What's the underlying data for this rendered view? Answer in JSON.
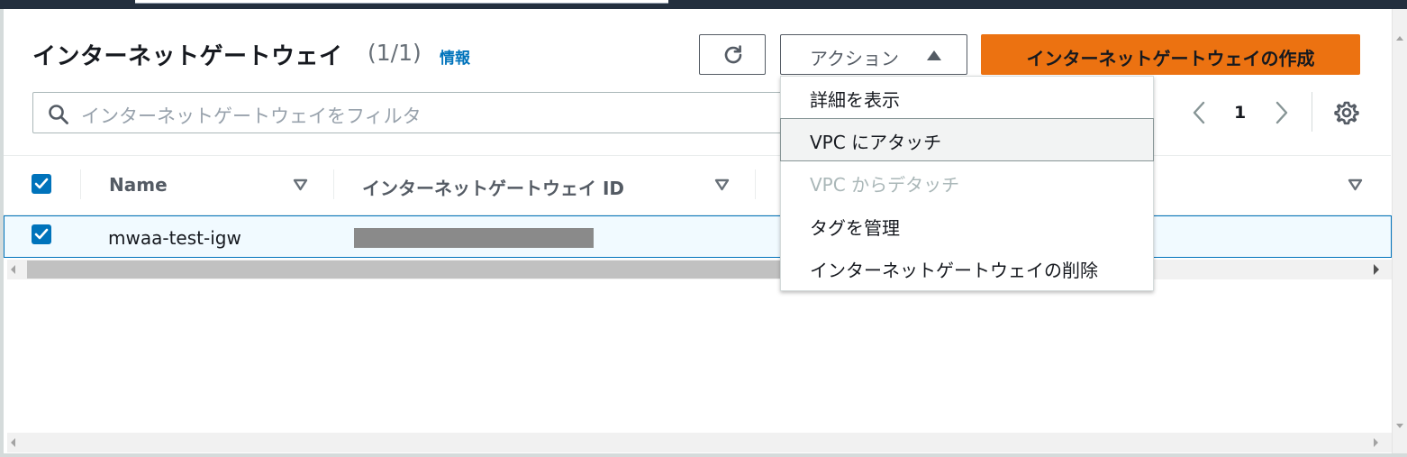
{
  "header": {
    "title": "インターネットゲートウェイ",
    "count": "(1/1)",
    "info_link": "情報"
  },
  "toolbar": {
    "actions_label": "アクション",
    "create_label": "インターネットゲートウェイの作成"
  },
  "filter": {
    "placeholder": "インターネットゲートウェイをフィルタ"
  },
  "pagination": {
    "current_page": "1"
  },
  "table": {
    "columns": [
      {
        "label": "Name"
      },
      {
        "label": "インターネットゲートウェイ ID"
      },
      {
        "label": ""
      }
    ],
    "rows": [
      {
        "selected": true,
        "name": "mwaa-test-igw",
        "id": ""
      }
    ]
  },
  "actions_menu": {
    "items": [
      {
        "label": "詳細を表示",
        "state": "normal"
      },
      {
        "label": "VPC にアタッチ",
        "state": "hover"
      },
      {
        "label": "VPC からデタッチ",
        "state": "disabled"
      },
      {
        "label": "タグを管理",
        "state": "normal"
      },
      {
        "label": "インターネットゲートウェイの削除",
        "state": "normal"
      }
    ]
  },
  "colors": {
    "primary_button": "#ec7211",
    "accent": "#0073bb",
    "text": "#16191f",
    "muted_text": "#545b64",
    "disabled_text": "#aab7b8"
  },
  "icons": {
    "refresh": "refresh-icon",
    "actions_caret": "caret-up-icon",
    "search": "search-icon",
    "prev": "chevron-left-icon",
    "next": "chevron-right-icon",
    "settings": "gear-icon",
    "sort": "sort-down-icon",
    "checkbox": "check-icon"
  }
}
